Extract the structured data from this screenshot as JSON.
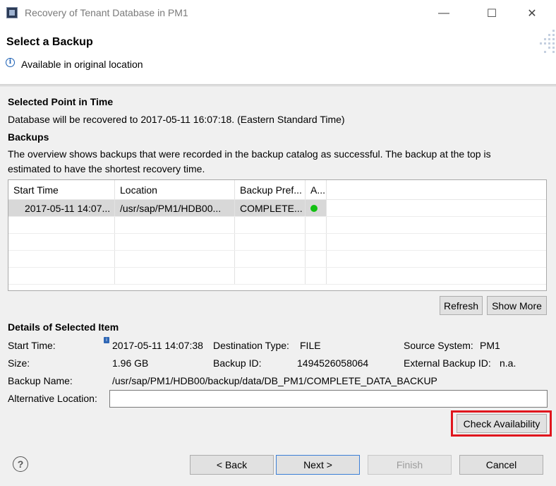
{
  "window": {
    "title": "Recovery of Tenant Database in PM1",
    "controls": {
      "minimize": "—",
      "maximize": "☐",
      "close": "✕"
    }
  },
  "banner": {
    "title": "Select a Backup",
    "message": "Available in original location"
  },
  "point_in_time": {
    "heading": "Selected Point in Time",
    "text": "Database will be recovered to 2017-05-11 16:07:18. (Eastern Standard Time)"
  },
  "backups": {
    "heading": "Backups",
    "description_line1": "The overview shows backups that were recorded in the backup catalog as successful. The backup at the top is",
    "description_line2": "estimated to have the shortest recovery time.",
    "columns": [
      "Start Time",
      "Location",
      "Backup Pref...",
      "A..."
    ],
    "rows": [
      {
        "start_time": "2017-05-11 14:07...",
        "location": "/usr/sap/PM1/HDB00...",
        "prefix": "COMPLETE...",
        "availability": "available"
      }
    ],
    "status_color": "#12c012",
    "refresh_label": "Refresh",
    "show_more_label": "Show More"
  },
  "details": {
    "heading": "Details of Selected Item",
    "start_time_label": "Start Time:",
    "start_time_value": "2017-05-11 14:07:38",
    "destination_type_label": "Destination Type:",
    "destination_type_value": "FILE",
    "source_system_label": "Source System:",
    "source_system_value": "PM1",
    "size_label": "Size:",
    "size_value": "1.96 GB",
    "backup_id_label": "Backup ID:",
    "backup_id_value": "1494526058064",
    "external_backup_id_label": "External Backup ID:",
    "external_backup_id_value": "n.a.",
    "backup_name_label": "Backup Name:",
    "backup_name_value": "/usr/sap/PM1/HDB00/backup/data/DB_PM1/COMPLETE_DATA_BACKUP",
    "alternative_location_label": "Alternative Location:",
    "alternative_location_value": "",
    "check_availability_label": "Check Availability",
    "highlight_color": "#e0161e"
  },
  "footer": {
    "help_icon": "?",
    "back_label": "< Back",
    "next_label": "Next >",
    "finish_label": "Finish",
    "cancel_label": "Cancel"
  }
}
